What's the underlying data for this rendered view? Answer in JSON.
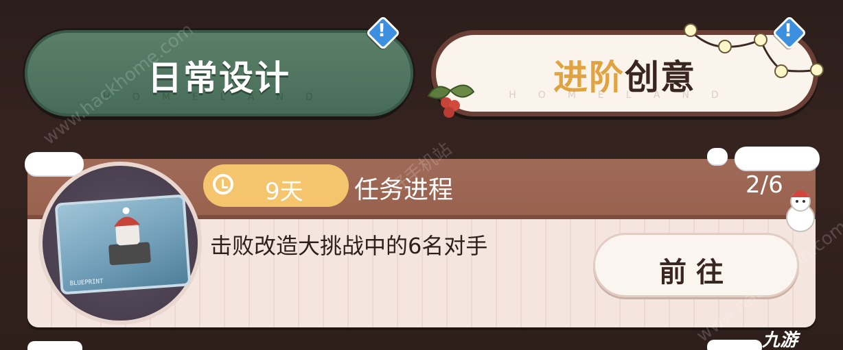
{
  "tabs": {
    "daily": {
      "label": "日常设计",
      "watermark": "HOMELAND"
    },
    "advanced": {
      "label_accent": "进阶",
      "label_rest": "创意",
      "watermark": "HOMELAND"
    }
  },
  "task": {
    "time_left": "9天",
    "title": "任务进程",
    "progress": "2/6",
    "progress_current": 2,
    "progress_total": 6,
    "description": "击败改造大挑战中的6名对手",
    "action_label": "前往",
    "reward_icon": "blueprint-icon",
    "reward_text": "BLUEPRINT"
  },
  "overlay": {
    "watermark_site": "www.hackhome.com",
    "watermark_site_2": "www.hackhome.com",
    "watermark_cn": "好手机站",
    "logo": "九游"
  },
  "colors": {
    "daily_tab": "#4f7560",
    "advanced_accent": "#e1a33f",
    "header_brown": "#98624f",
    "timer_yellow": "#f5c56d",
    "badge_blue": "#3d8fe0"
  }
}
